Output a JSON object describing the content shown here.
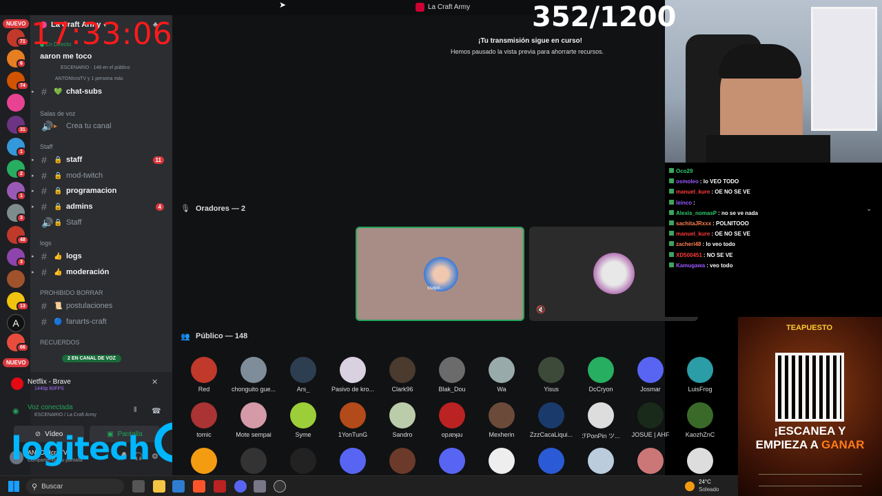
{
  "overlay": {
    "clock": "17:33:06",
    "counter": "352/1200",
    "logo_text": "logitech"
  },
  "window": {
    "title": "La Craft Army"
  },
  "rail": {
    "nuevo_top": "NUEVO",
    "nuevo_bottom": "NUEVO",
    "badges": [
      "71",
      "6",
      "74",
      "31",
      "1",
      "2",
      "1",
      "3",
      "48",
      "3",
      "13",
      "66"
    ]
  },
  "sidebar": {
    "server_name": "La Craft Army",
    "stage": {
      "status": "En Directo",
      "title": "aaron me toco",
      "meta": "ESCENARIO · 148 en el público",
      "hosts": "ANTONIcraTV y 1 persona más"
    },
    "channels": [
      {
        "name": "chat-subs",
        "bold": true,
        "emoji": "💚",
        "type": "text"
      },
      {
        "category": "Salas de voz"
      },
      {
        "name": "Crea tu canal",
        "bold": false,
        "emoji": "▸",
        "type": "voice"
      },
      {
        "category": "Staff"
      },
      {
        "name": "staff",
        "bold": true,
        "emoji": "🔒",
        "type": "text",
        "unread": "11"
      },
      {
        "name": "mod-twitch",
        "bold": false,
        "emoji": "🔒",
        "type": "text"
      },
      {
        "name": "programacion",
        "bold": true,
        "emoji": "🔒",
        "type": "text"
      },
      {
        "name": "admins",
        "bold": true,
        "emoji": "🔒",
        "type": "text",
        "unread": "4"
      },
      {
        "name": "Staff",
        "bold": false,
        "emoji": "🔒",
        "type": "voice"
      },
      {
        "category": "logs"
      },
      {
        "name": "logs",
        "bold": true,
        "emoji": "👍",
        "type": "text"
      },
      {
        "name": "moderación",
        "bold": true,
        "emoji": "👍",
        "type": "text"
      },
      {
        "category": "PROHIBIDO BORRAR"
      },
      {
        "name": "postulaciones",
        "bold": false,
        "emoji": "📜",
        "type": "text"
      },
      {
        "name": "fanarts-craft",
        "bold": false,
        "emoji": "🔵",
        "type": "text"
      },
      {
        "category": "RECUERDOS"
      }
    ],
    "voice_pill": "2 EN CANAL DE VOZ"
  },
  "user_panel": {
    "stream_title": "Netflix - Brave",
    "stream_quality": "1440p 60FPS",
    "voice_status": "Voz conectada",
    "voice_location": "ESCENARIO / La Craft Army",
    "video_label": "Vídeo",
    "screen_label": "Pantalla",
    "username": "ANTONIcraTV",
    "user_status": "Compartiendo su pantalla"
  },
  "main": {
    "banner_title": "¡Tu transmisión sigue en curso!",
    "banner_sub": "Hemos pausado la vista previa para ahorrarte recursos.",
    "speakers_label": "Oradores — 2",
    "speaker_caption": "ssapo..",
    "audience_label": "Público — 148",
    "audience_row1": [
      "Red",
      "chonguito gue...",
      "Ars_",
      "Pasivo de kro...",
      "Clark96",
      "Blak_Dou",
      "Wa",
      "Yisus",
      "DcCryon",
      "Josmar",
      "LuisFrog"
    ],
    "audience_row2": [
      "tomic",
      "Mote sempai",
      "Syme",
      "1YonTunG",
      "Sandro",
      "opɹɐʞǝɹ",
      "Mexherin",
      "ZzzCacaLiqui...",
      "ℱPonPin ツ...",
      "JOSUE | AHF",
      "KaozhZnC"
    ]
  },
  "chat": {
    "lines": [
      {
        "user": "Oco29",
        "text": "",
        "color": "#2ecc71"
      },
      {
        "user": "osmoleo",
        "text": ": lo VEO TODO",
        "color": "#9b59ff"
      },
      {
        "user": "manuel_kure",
        "text": ": OE NO SE VE",
        "color": "#ff3b3b"
      },
      {
        "user": "leinco",
        "text": ":",
        "color": "#9b59ff"
      },
      {
        "user": "Alexis_nomasP",
        "text": ": no se ve nada",
        "color": "#2ecc71"
      },
      {
        "user": "sachitaJRxxx",
        "text": ": POLNITOOO",
        "color": "#ff7f50"
      },
      {
        "user": "manuel_kure",
        "text": ": OE NO SE VE",
        "color": "#ff3b3b"
      },
      {
        "user": "zacheri48",
        "text": ": lo veo todo",
        "color": "#ff7f50"
      },
      {
        "user": "XD500451",
        "text": ": NO SE VE",
        "color": "#ff3b3b"
      },
      {
        "user": "Kamugawa",
        "text": ": veo todo",
        "color": "#9b59ff"
      }
    ]
  },
  "ad": {
    "brand": "TEAPUESTO",
    "line1": "¡ESCANEA Y",
    "line2_a": "EMPIEZA A",
    "line2_b": "GANAR"
  },
  "taskbar": {
    "search_placeholder": "Buscar",
    "weather_temp": "24°C",
    "weather_desc": "Soleado"
  }
}
